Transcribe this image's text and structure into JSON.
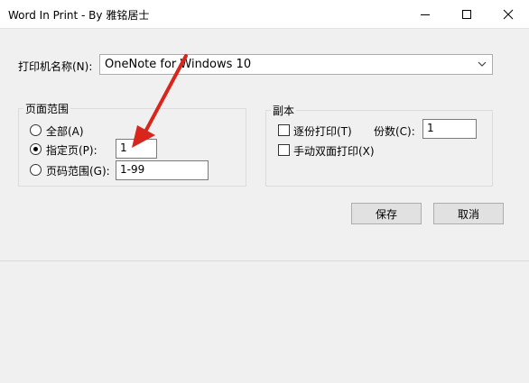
{
  "window": {
    "title": "Word In Print - By 雅铭居士",
    "icons": {
      "minimize": "minimize-icon",
      "maximize": "maximize-icon",
      "close": "close-icon"
    }
  },
  "printer": {
    "label": "打印机名称(N):",
    "selected": "OneNote for Windows 10"
  },
  "page_range": {
    "legend": "页面范围",
    "all_label": "全部(A)",
    "specified_label": "指定页(P):",
    "specified_value": "1",
    "range_label": "页码范围(G):",
    "range_value": "1-99",
    "selected": "specified"
  },
  "copies": {
    "legend": "副本",
    "collate_label": "逐份打印(T)",
    "count_label": "份数(C):",
    "count_value": "1",
    "duplex_label": "手动双面打印(X)"
  },
  "buttons": {
    "save": "保存",
    "cancel": "取消"
  },
  "annotation": {
    "arrow_color": "#d9261c"
  }
}
